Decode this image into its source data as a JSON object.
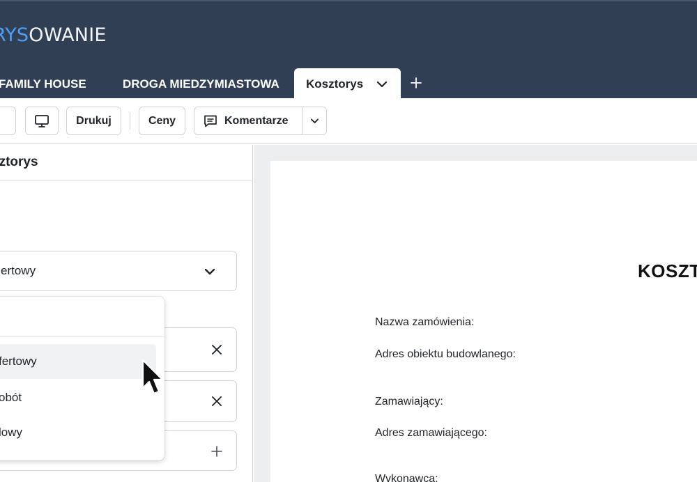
{
  "app": {
    "brand_part1": "RYS",
    "brand_part2": "OWANIE"
  },
  "tabs": [
    {
      "label": "E FAMILY HOUSE"
    },
    {
      "label": "DROGA MIEDZYMIASTOWA"
    },
    {
      "label": "Kosztorys"
    }
  ],
  "toolbar": {
    "print_label": "Drukuj",
    "prices_label": "Ceny",
    "comments_label": "Komentarze"
  },
  "left_panel": {
    "title": "sztorys",
    "select_value": "ertowy"
  },
  "dropdown": {
    "options": [
      "fertowy",
      "obót",
      "lowy"
    ],
    "highlighted_index": 0
  },
  "document": {
    "title": "KOSZT",
    "fields": [
      "Nazwa zamówienia:",
      "Adres obiektu budowlanego:",
      "Zamawiający:",
      "Adres zamawiającego:",
      "Wykonawca:"
    ]
  },
  "colors": {
    "header_bg": "#313f54",
    "brand_accent": "#4e9ef5",
    "preview_bg": "#edeef0"
  },
  "icons": {
    "monitor": "monitor-icon",
    "comment": "comment-icon",
    "chevron": "chevron-down-icon",
    "close": "close-icon",
    "plus": "plus-icon",
    "cursor": "mouse-pointer"
  }
}
